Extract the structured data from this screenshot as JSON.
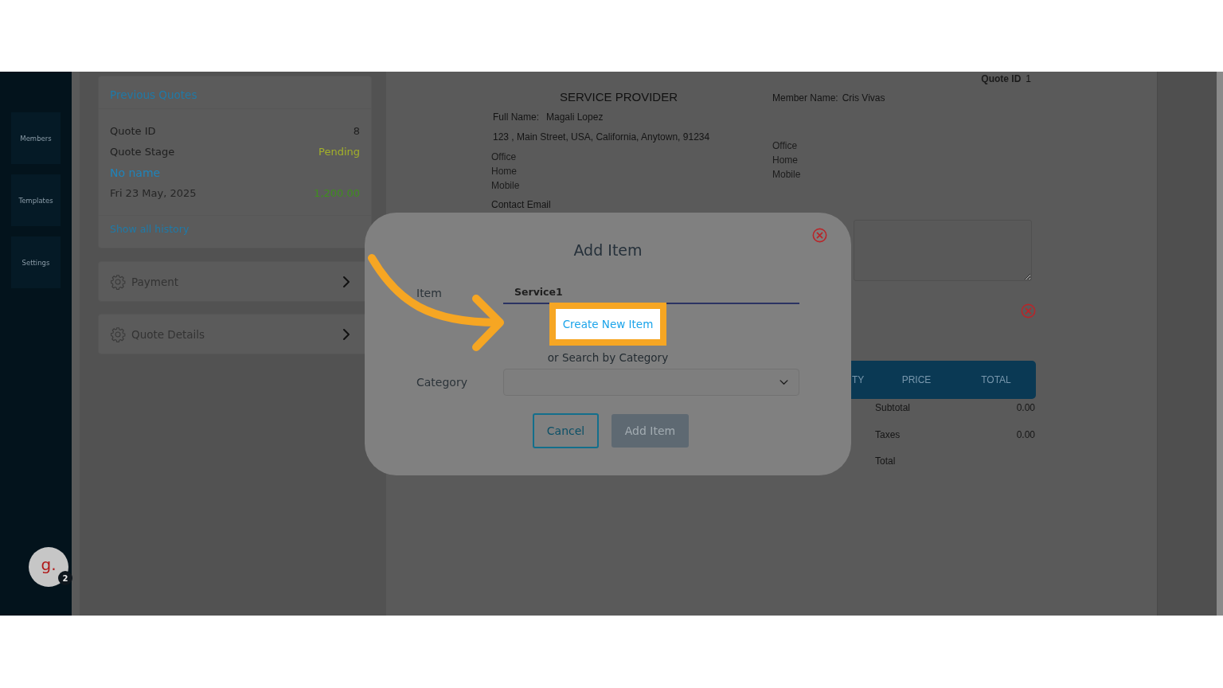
{
  "sidebar": {
    "items": [
      {
        "label": "Members"
      },
      {
        "label": "Templates"
      },
      {
        "label": "Settings"
      }
    ],
    "avatar": {
      "initial": "g.",
      "badge": "2"
    }
  },
  "previous_quotes": {
    "title": "Previous Quotes",
    "rows": [
      {
        "kind": "plain",
        "label": "Quote ID",
        "value": "8"
      },
      {
        "kind": "status",
        "label": "Quote Stage",
        "value": "Pending"
      },
      {
        "kind": "name",
        "label": "No name"
      },
      {
        "kind": "amount",
        "label": "Fri 23 May, 2025",
        "value": "1,200.00"
      }
    ],
    "link": "Show all history"
  },
  "sections": [
    {
      "label": "Payment",
      "expanded": false
    },
    {
      "label": "Quote Details",
      "expanded": false
    }
  ],
  "document": {
    "quote_id": {
      "label": "Quote ID",
      "value": "1"
    },
    "provider": {
      "heading": "SERVICE PROVIDER",
      "full_name_label": "Full Name:",
      "full_name": "Magali Lopez",
      "address": "123 , Main Street, USA, California, Anytown, 91234",
      "phones": [
        "Office",
        "Home",
        "Mobile"
      ],
      "email_label": "Contact Email"
    },
    "member": {
      "name_label": "Member Name:",
      "name": "Cris Vivas",
      "phones": [
        "Office",
        "Home",
        "Mobile"
      ]
    },
    "table": {
      "columns": [
        "TY",
        "PRICE",
        "TOTAL"
      ]
    },
    "totals": [
      {
        "label": "Subtotal",
        "value": "0.00"
      },
      {
        "label": "Taxes",
        "value": "0.00"
      },
      {
        "label": "Total"
      }
    ]
  },
  "dialog": {
    "title": "Add Item",
    "item": {
      "label": "Item",
      "value": "Service1"
    },
    "create_link": "Create New Item",
    "hint": "or Search by Category",
    "category": {
      "label": "Category"
    },
    "buttons": [
      {
        "label": "Cancel",
        "kind": "secondary",
        "disabled": false
      },
      {
        "label": "Add Item",
        "kind": "primary",
        "disabled": true
      }
    ]
  }
}
